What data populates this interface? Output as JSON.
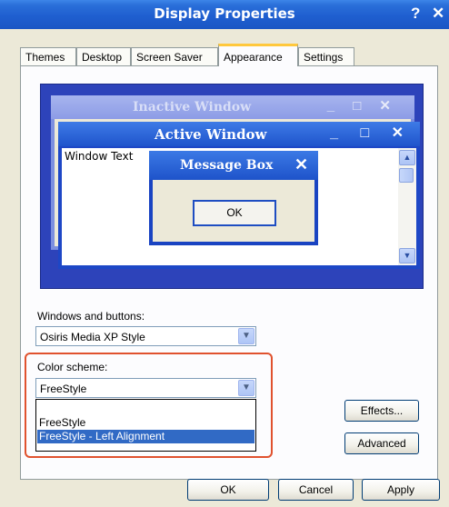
{
  "window": {
    "title": "Display Properties",
    "help_glyph": "?",
    "close_glyph": "✕"
  },
  "tabs": [
    {
      "label": "Themes"
    },
    {
      "label": "Desktop"
    },
    {
      "label": "Screen Saver"
    },
    {
      "label": "Appearance",
      "active": true
    },
    {
      "label": "Settings"
    }
  ],
  "preview": {
    "inactive_title": "Inactive Window",
    "inactive_controls": "_ □ ✕",
    "active_title": "Active Window",
    "active_controls": "_ □ ✕",
    "window_text": "Window Text",
    "message_box_title": "Message Box",
    "message_box_close": "✕",
    "message_box_button": "OK",
    "scroll_up": "▲",
    "scroll_down": "▼"
  },
  "windows_and_buttons": {
    "label": "Windows and buttons:",
    "value": "Osiris Media XP Style"
  },
  "color_scheme": {
    "label": "Color scheme:",
    "value": "FreeStyle",
    "options": [
      {
        "label": "FreeStyle",
        "selected": false
      },
      {
        "label": "FreeStyle - Left Alignment",
        "selected": true
      }
    ]
  },
  "side_buttons": {
    "effects": "Effects...",
    "advanced": "Advanced"
  },
  "footer": {
    "ok": "OK",
    "cancel": "Cancel",
    "apply": "Apply"
  },
  "colors": {
    "title_bar": "#1f5fd0",
    "selection": "#316ac5",
    "highlight_border": "#e0522e",
    "face": "#ece9d8"
  },
  "icons": {
    "dropdown": "chevron-down-icon",
    "help": "help-icon",
    "close": "close-icon"
  }
}
